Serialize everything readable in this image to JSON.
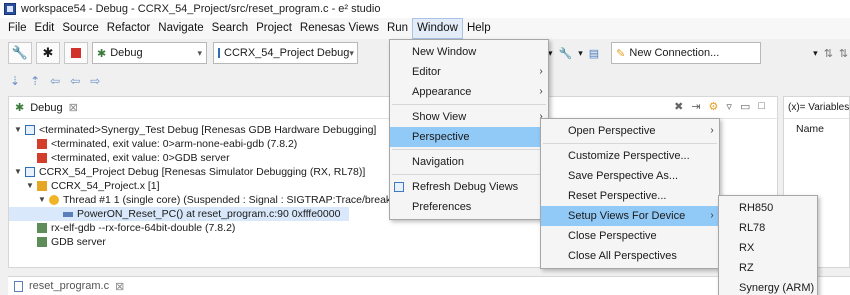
{
  "window": {
    "title": "workspace54 - Debug - CCRX_54_Project/src/reset_program.c - e² studio"
  },
  "menubar": {
    "items": [
      {
        "label": "File"
      },
      {
        "label": "Edit"
      },
      {
        "label": "Source"
      },
      {
        "label": "Refactor"
      },
      {
        "label": "Navigate"
      },
      {
        "label": "Search"
      },
      {
        "label": "Project"
      },
      {
        "label": "Renesas Views"
      },
      {
        "label": "Run"
      },
      {
        "label": "Window"
      },
      {
        "label": "Help"
      }
    ]
  },
  "toolbar": {
    "debug_combo": "Debug",
    "config_combo": "CCRX_54_Project Debug",
    "connection_combo": "New Connection..."
  },
  "debug_view": {
    "tab_label": "Debug",
    "tab_close": "⊠",
    "tree": [
      {
        "text": "<terminated>Synergy_Test Debug [Renesas GDB Hardware Debugging]"
      },
      {
        "text": "<terminated, exit value: 0>arm-none-eabi-gdb (7.8.2)"
      },
      {
        "text": "<terminated, exit value: 0>GDB server"
      },
      {
        "text": "CCRX_54_Project Debug [Renesas Simulator Debugging (RX, RL78)]"
      },
      {
        "text": "CCRX_54_Project.x [1]"
      },
      {
        "text": "Thread #1 1 (single core) (Suspended : Signal : SIGTRAP:Trace/breakpoi"
      },
      {
        "text": "PowerON_Reset_PC() at reset_program.c:90 0xfffe0000"
      },
      {
        "text": "rx-elf-gdb --rx-force-64bit-double (7.8.2)"
      },
      {
        "text": "GDB server"
      }
    ]
  },
  "variables_view": {
    "tab_label": "(x)= Variables",
    "column_name": "Name"
  },
  "editor": {
    "tab_label": "reset_program.c",
    "tab_close": "⊠"
  },
  "window_menu": {
    "items": [
      {
        "label": "New Window"
      },
      {
        "label": "Editor"
      },
      {
        "label": "Appearance"
      },
      {
        "label": "Show View"
      },
      {
        "label": "Perspective"
      },
      {
        "label": "Navigation"
      },
      {
        "label": "Refresh Debug Views"
      },
      {
        "label": "Preferences"
      }
    ]
  },
  "perspective_menu": {
    "items": [
      {
        "label": "Open Perspective"
      },
      {
        "label": "Customize Perspective..."
      },
      {
        "label": "Save Perspective As..."
      },
      {
        "label": "Reset Perspective..."
      },
      {
        "label": "Setup Views For Device"
      },
      {
        "label": "Close Perspective"
      },
      {
        "label": "Close All Perspectives"
      }
    ]
  },
  "devices_menu": {
    "items": [
      {
        "label": "RH850"
      },
      {
        "label": "RL78"
      },
      {
        "label": "RX"
      },
      {
        "label": "RZ"
      },
      {
        "label": "Synergy (ARM)"
      }
    ]
  },
  "colors": {
    "menu_highlight": "#91c9f7",
    "selection": "#d9e8fb"
  }
}
